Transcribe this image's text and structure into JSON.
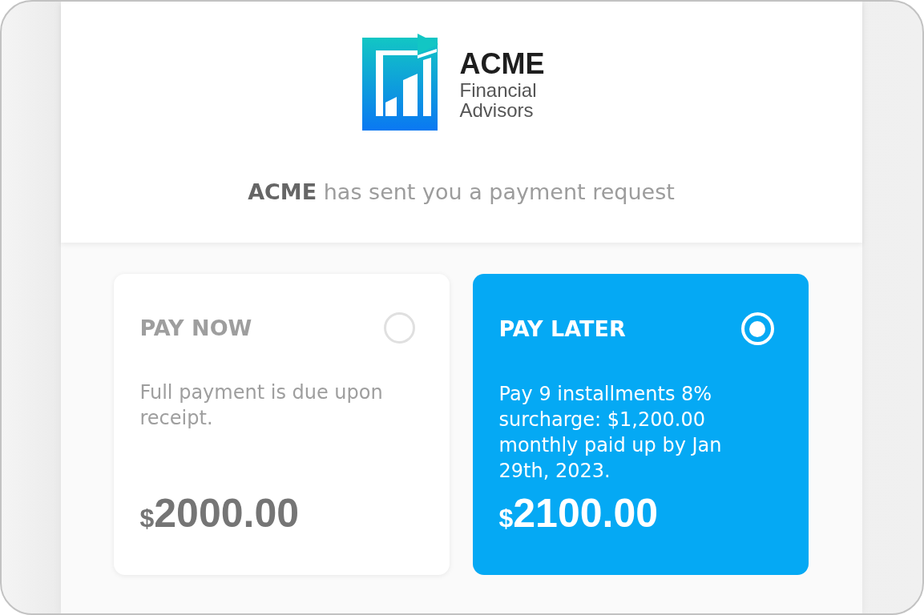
{
  "header": {
    "logo": {
      "name": "ACME",
      "tagline": "Financial Advisors"
    },
    "message": "**ACME** has sent you a payment request"
  },
  "options": [
    {
      "title": "PAY NOW",
      "description": "Full payment is due upon receipt.",
      "currency": "$",
      "amount": "2000.00",
      "selected": false
    },
    {
      "title": "PAY LATER",
      "description": "Pay 9 installments 8% surcharge: $1,200.00 monthly paid up by Jan 29th, 2023.",
      "currency": "$",
      "amount": "2100.00",
      "selected": true
    }
  ]
}
